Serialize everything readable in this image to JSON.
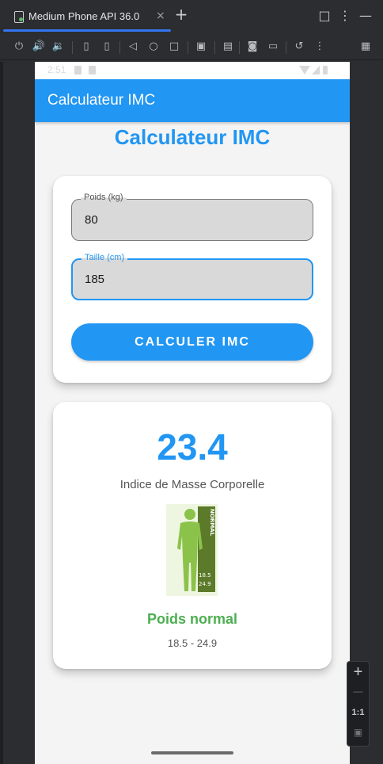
{
  "ide": {
    "tab_label": "Medium Phone API 36.0",
    "tab_close": "×",
    "new_tab": "+",
    "window_maximize": "□",
    "window_menu": "⋮",
    "window_minimize": "—"
  },
  "toolbar": {
    "icons": [
      "power-icon",
      "volume-up-icon",
      "volume-down-icon",
      "rotate-left-icon",
      "rotate-right-icon",
      "back-icon",
      "home-icon",
      "overview-icon",
      "screenshot-fold-icon",
      "device-settings-icon",
      "camera-icon",
      "record-icon",
      "snapshot-icon",
      "more-icon",
      "device-manager-icon"
    ]
  },
  "device": {
    "status_time": "2:51",
    "app_title": "Calculateur IMC",
    "heading": "Calculateur IMC",
    "weight": {
      "label": "Poids (kg)",
      "value": "80"
    },
    "height": {
      "label": "Taille (cm)",
      "value": "185"
    },
    "calc_button": "CALCULER IMC",
    "result": {
      "bmi": "23.4",
      "caption": "Indice de Masse Corporelle",
      "figure_label": "NORMAL",
      "figure_range_low": "18.5",
      "figure_range_high": "24.9",
      "category": "Poids normal",
      "range": "18.5 - 24.9"
    }
  },
  "zoom": {
    "plus": "+",
    "minus": "—",
    "one_to_one": "1:1"
  },
  "colors": {
    "primary": "#2196f3",
    "success": "#4caf50",
    "figure_green": "#8bc34a",
    "figure_dark": "#5b7a2a"
  }
}
